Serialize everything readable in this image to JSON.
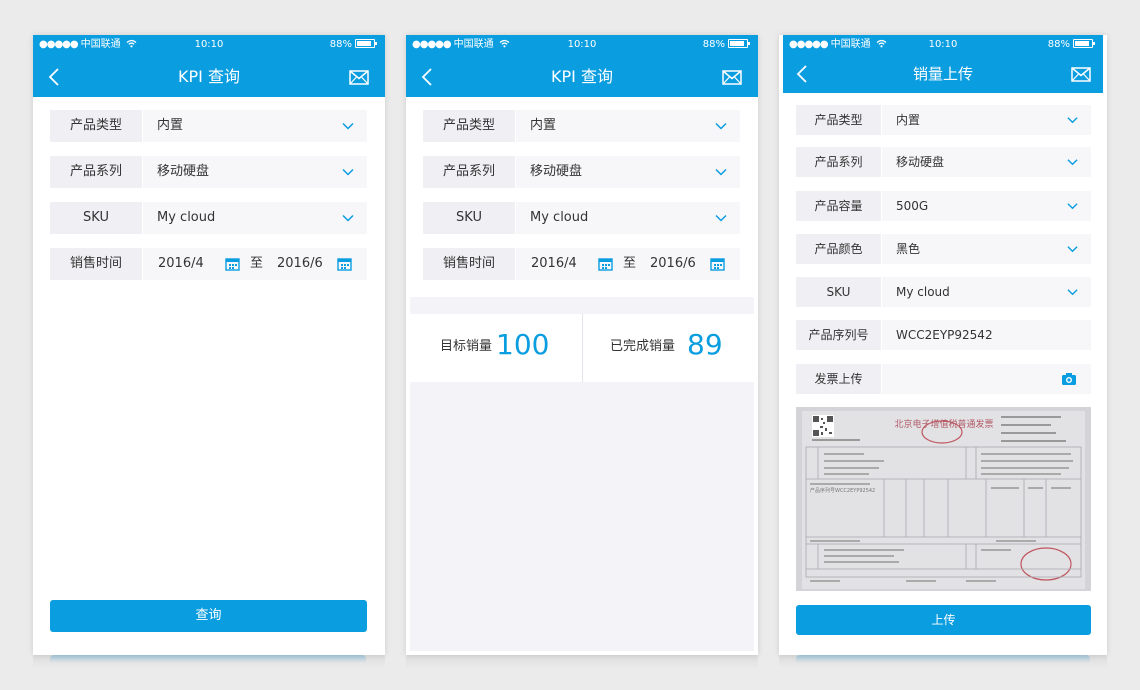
{
  "status": {
    "carrier": "中国联通",
    "time": "10:10",
    "battery": "88%"
  },
  "colors": {
    "primary": "#0a9de0",
    "label_bg": "#f0f0f4",
    "value_bg": "#f7f7fa"
  },
  "screen1": {
    "title": "KPI 查询",
    "fields": [
      {
        "label": "产品类型",
        "value": "内置"
      },
      {
        "label": "产品系列",
        "value": "移动硬盘"
      },
      {
        "label": "SKU",
        "value": "My cloud"
      }
    ],
    "date": {
      "label": "销售时间",
      "from": "2016/4",
      "sep": "至",
      "to": "2016/6"
    },
    "button": "查询"
  },
  "screen2": {
    "title": "KPI 查询",
    "fields": [
      {
        "label": "产品类型",
        "value": "内置"
      },
      {
        "label": "产品系列",
        "value": "移动硬盘"
      },
      {
        "label": "SKU",
        "value": "My cloud"
      }
    ],
    "date": {
      "label": "销售时间",
      "from": "2016/4",
      "sep": "至",
      "to": "2016/6"
    },
    "target": {
      "label": "目标销量",
      "value": "100"
    },
    "done": {
      "label": "已完成销量",
      "value": "89"
    }
  },
  "screen3": {
    "title": "销量上传",
    "fields": [
      {
        "label": "产品类型",
        "value": "内置"
      },
      {
        "label": "产品系列",
        "value": "移动硬盘"
      },
      {
        "label": "产品容量",
        "value": "500G"
      },
      {
        "label": "产品颜色",
        "value": "黑色"
      },
      {
        "label": "SKU",
        "value": "My cloud"
      }
    ],
    "serial": {
      "label": "产品序列号",
      "value": "WCC2EYP92542"
    },
    "invoice_upload": {
      "label": "发票上传"
    },
    "invoice_image": {
      "heading": "北京电子增值税普通发票",
      "serial_text": "产品序列号WCC2EYP92542"
    },
    "button": "上传"
  },
  "icons": {
    "back": "chevron-left-icon",
    "mail": "envelope-icon",
    "dropdown": "chevron-down-icon",
    "calendar": "calendar-icon",
    "camera": "camera-icon",
    "signal": "signal-dots-icon",
    "wifi": "wifi-icon",
    "battery": "battery-icon"
  }
}
